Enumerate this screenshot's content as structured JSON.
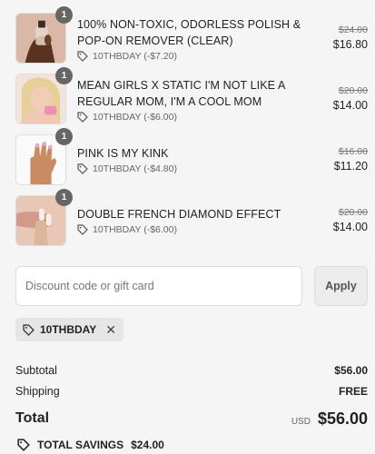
{
  "items": [
    {
      "quantity": "1",
      "title": "100% NON-TOXIC, ODORLESS POLISH & POP-ON REMOVER (CLEAR)",
      "discount": "10THBDAY (-$7.20)",
      "original_price": "$24.00",
      "price": "$16.80",
      "thumb": "polish-bottle-hand"
    },
    {
      "quantity": "1",
      "title": "MEAN GIRLS X STATIC I'M NOT LIKE A REGULAR MOM, I'M A COOL MOM",
      "discount": "10THBDAY (-$6.00)",
      "original_price": "$20.00",
      "price": "$14.00",
      "thumb": "blonde-woman-pink-nails"
    },
    {
      "quantity": "1",
      "title": "PINK IS MY KINK",
      "discount": "10THBDAY (-$4.80)",
      "original_price": "$16.00",
      "price": "$11.20",
      "thumb": "pink-nails-hand"
    },
    {
      "quantity": "1",
      "title": "DOUBLE FRENCH DIAMOND EFFECT",
      "discount": "10THBDAY (-$6.00)",
      "original_price": "$20.00",
      "price": "$14.00",
      "thumb": "french-nails-lips"
    }
  ],
  "discount_form": {
    "placeholder": "Discount code or gift card",
    "apply_label": "Apply"
  },
  "applied_code": "10THBDAY",
  "summary": {
    "subtotal_label": "Subtotal",
    "subtotal_value": "$56.00",
    "shipping_label": "Shipping",
    "shipping_value": "FREE",
    "total_label": "Total",
    "currency": "USD",
    "total_value": "$56.00",
    "savings_label": "TOTAL SAVINGS",
    "savings_value": "$24.00"
  },
  "icons": {
    "tag": "tag-icon",
    "remove": "close-icon"
  },
  "colors": {
    "background": "#f5f5f5",
    "badge": "#666666"
  }
}
